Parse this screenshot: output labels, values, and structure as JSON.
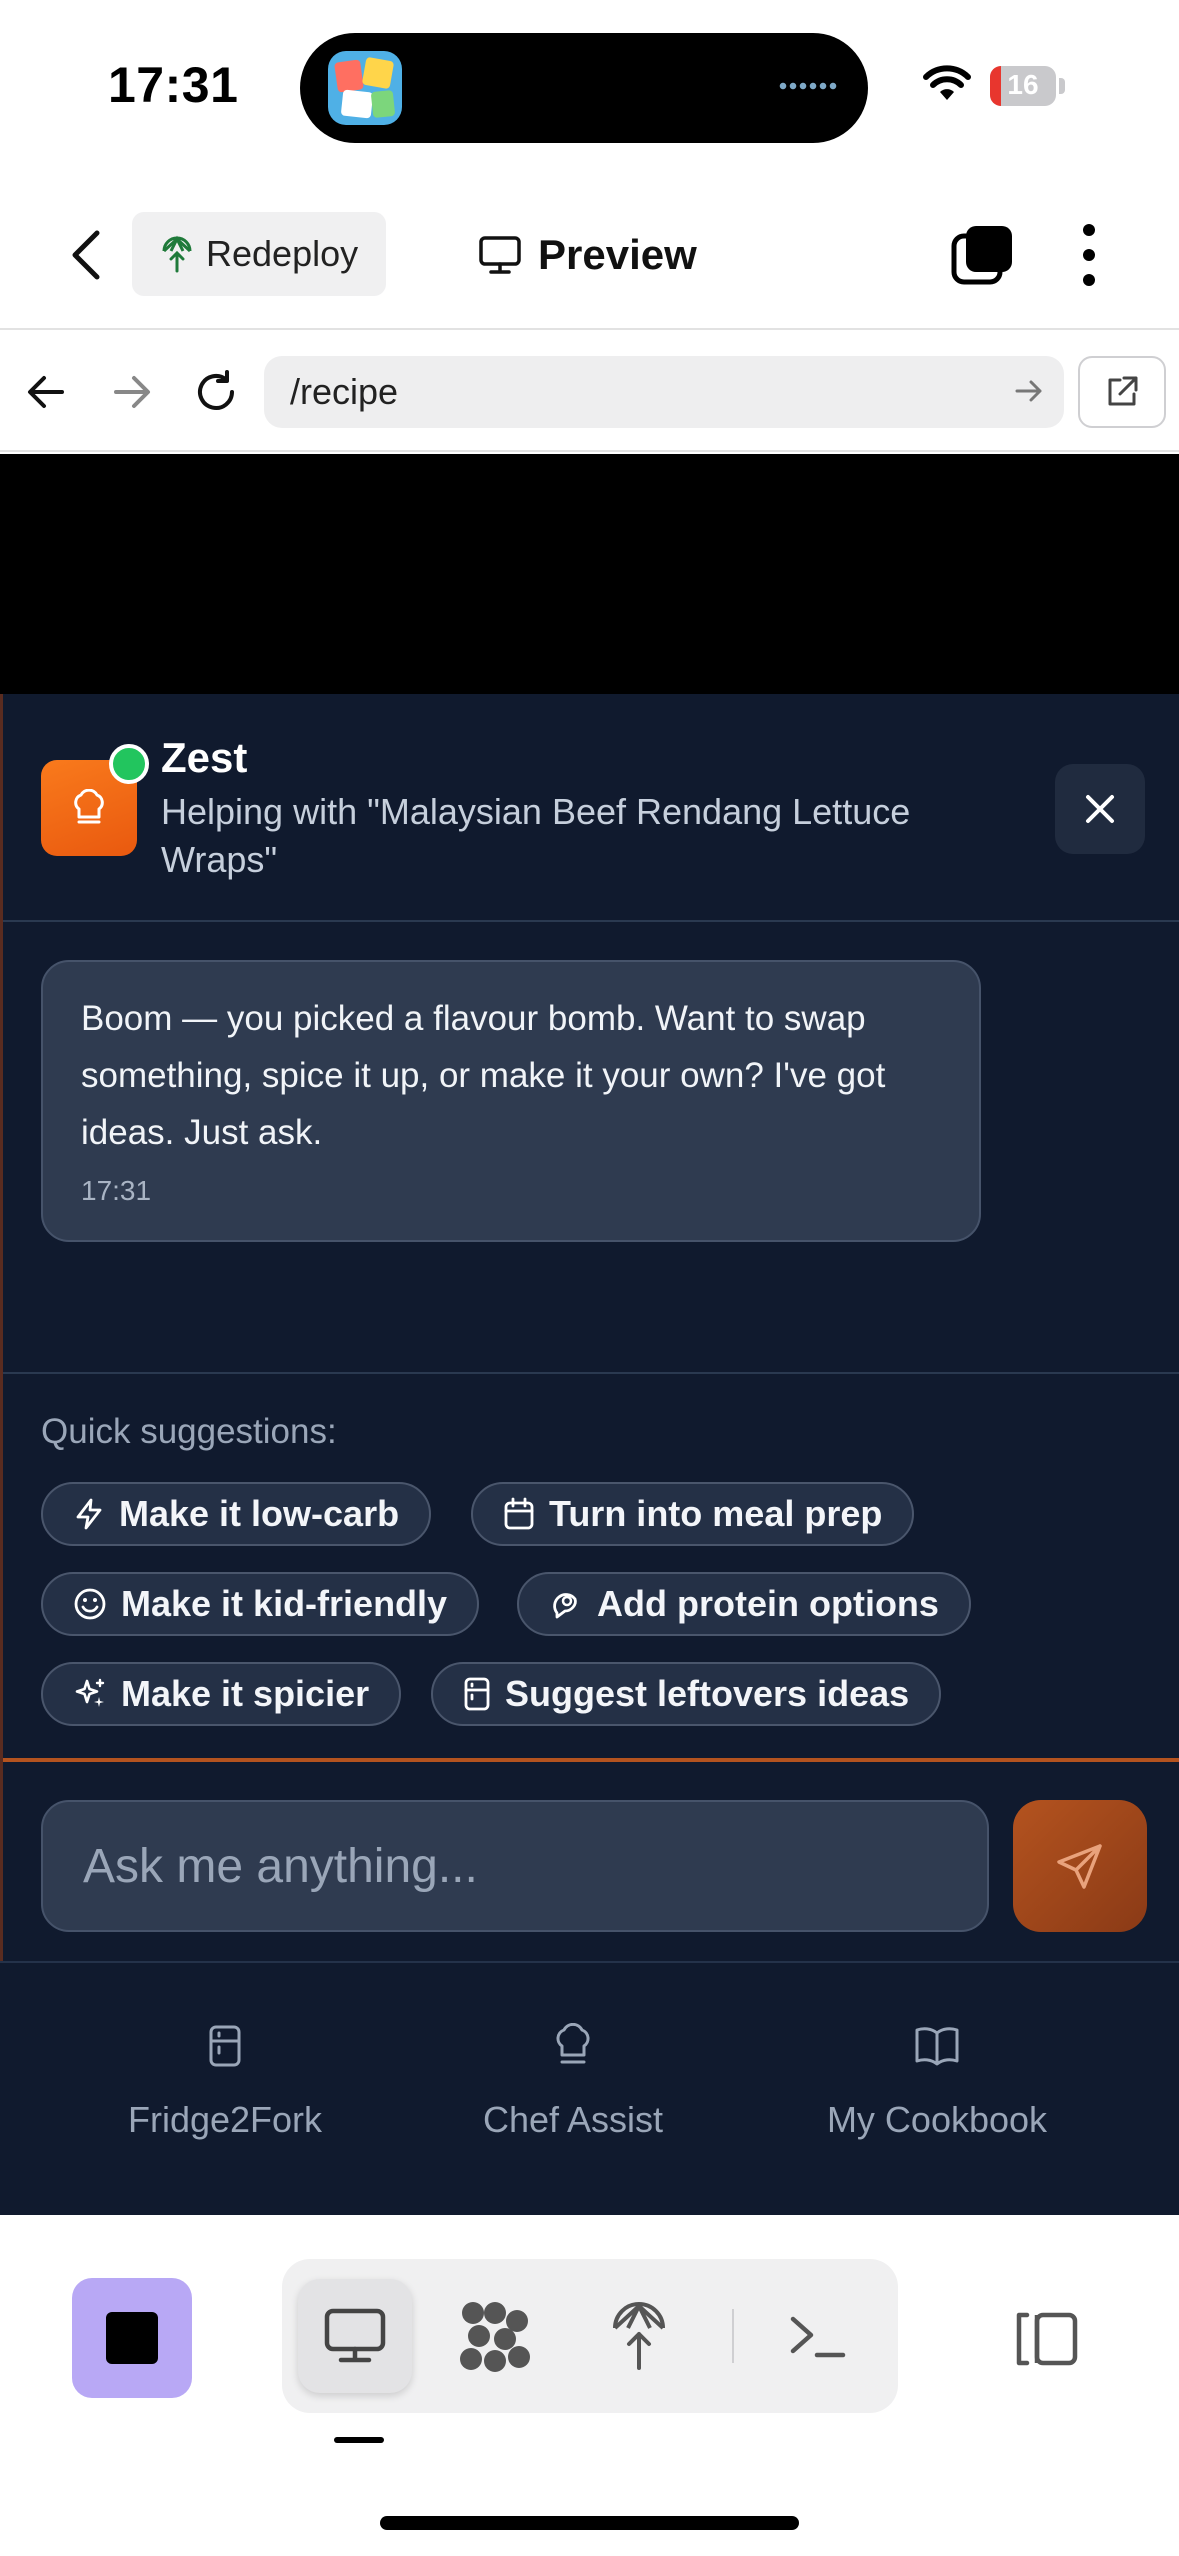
{
  "status_bar": {
    "time": "17:31",
    "battery_level": "16",
    "battery_color": "#e8362e"
  },
  "header": {
    "redeploy_label": "Redeploy",
    "preview_label": "Preview"
  },
  "browser": {
    "url": "/recipe"
  },
  "chat": {
    "assistant_name": "Zest",
    "subtitle": "Helping with \"Malaysian Beef Rendang Lettuce Wraps\"",
    "messages": [
      {
        "text": "Boom — you picked a flavour bomb. Want to swap something, spice it up, or make it your own? I've got ideas. Just ask.",
        "time": "17:31"
      }
    ],
    "suggestions_label": "Quick suggestions:",
    "suggestions": [
      {
        "label": "Make it low-carb",
        "icon": "lightning-icon"
      },
      {
        "label": "Turn into meal prep",
        "icon": "calendar-icon"
      },
      {
        "label": "Make it kid-friendly",
        "icon": "smile-icon"
      },
      {
        "label": "Add protein options",
        "icon": "meat-icon"
      },
      {
        "label": "Make it spicier",
        "icon": "sparkle-icon"
      },
      {
        "label": "Suggest leftovers ideas",
        "icon": "fridge-icon"
      }
    ],
    "input_placeholder": "Ask me anything...",
    "accent_color": "#b4531f",
    "online_color": "#22c55e"
  },
  "bottom_nav": {
    "items": [
      {
        "label": "Fridge2Fork",
        "icon": "fridge-icon"
      },
      {
        "label": "Chef Assist",
        "icon": "chef-hat-icon"
      },
      {
        "label": "My Cookbook",
        "icon": "book-icon"
      }
    ]
  },
  "toolbar": {
    "stop_color": "#b8a8f5",
    "tools": [
      {
        "name": "preview",
        "icon": "monitor-icon",
        "active": true
      },
      {
        "name": "workflow",
        "icon": "nodes-icon",
        "active": false
      },
      {
        "name": "deploy",
        "icon": "deploy-icon",
        "active": false
      },
      {
        "name": "shell",
        "icon": "terminal-icon",
        "active": false
      }
    ]
  }
}
